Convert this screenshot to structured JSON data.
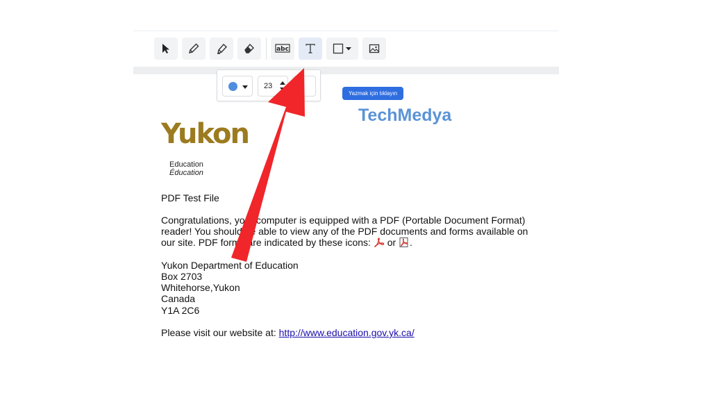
{
  "toolbar": {
    "tools": [
      {
        "name": "select",
        "icon": "cursor-arrow-icon"
      },
      {
        "name": "pencil",
        "icon": "pencil-icon"
      },
      {
        "name": "highlighter",
        "icon": "highlighter-icon"
      },
      {
        "name": "eraser",
        "icon": "eraser-icon"
      },
      {
        "name": "text-recognition",
        "icon": "abc-text-box-icon",
        "label": "abc"
      },
      {
        "name": "text",
        "icon": "text-t-icon",
        "label": "T",
        "active": true
      },
      {
        "name": "shape",
        "icon": "square-shape-icon"
      },
      {
        "name": "image",
        "icon": "image-icon"
      }
    ]
  },
  "text_options": {
    "color": "#4f8ddf",
    "font_size": "23"
  },
  "tooltip": {
    "text": "Yazmak için tıklayın"
  },
  "watermark": {
    "text": "TechMedya"
  },
  "logo": {
    "word": "Yukon",
    "line1": "Education",
    "line2": "Éducation"
  },
  "document": {
    "title": "PDF Test File",
    "paragraph_lines": [
      "Congratulations, your computer is equipped with a PDF (Portable Document Format)",
      "reader!  You should be able to view any of the PDF documents and forms available on",
      "our site.  PDF forms are indicated by these icons:"
    ],
    "icons_or": "or",
    "icons_end": ".",
    "address": [
      "Yukon Department of Education",
      "Box 2703",
      "Whitehorse,Yukon",
      "Canada",
      "Y1A 2C6"
    ],
    "website_prefix": "Please visit our website at:",
    "website_link": "http://www.education.gov.yk.ca/"
  },
  "colors": {
    "accent": "#2f6ee0",
    "arrow": "#f0262a",
    "logo_gold": "#9c7b20",
    "watermark": "#5b93d6"
  }
}
